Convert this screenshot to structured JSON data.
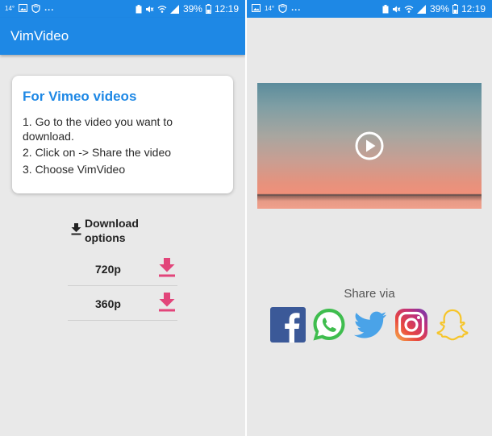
{
  "status_bar": {
    "temperature": "14°",
    "overflow_dots": "...",
    "battery_percent": "39%",
    "time": "12:19"
  },
  "app": {
    "title": "VimVideo"
  },
  "instructions": {
    "title": "For Vimeo videos",
    "steps": [
      "1. Go to the video you want to download.",
      "2. Click on -> Share the video",
      "3. Choose VimVideo"
    ]
  },
  "download": {
    "header": "Download options",
    "options": [
      {
        "label": "720p"
      },
      {
        "label": "360p"
      }
    ]
  },
  "share": {
    "label": "Share via",
    "targets": [
      "facebook-icon",
      "whatsapp-icon",
      "twitter-icon",
      "instagram-icon",
      "snapchat-icon"
    ]
  },
  "colors": {
    "primary": "#1e88e5",
    "download_accent": "#e2457a"
  }
}
